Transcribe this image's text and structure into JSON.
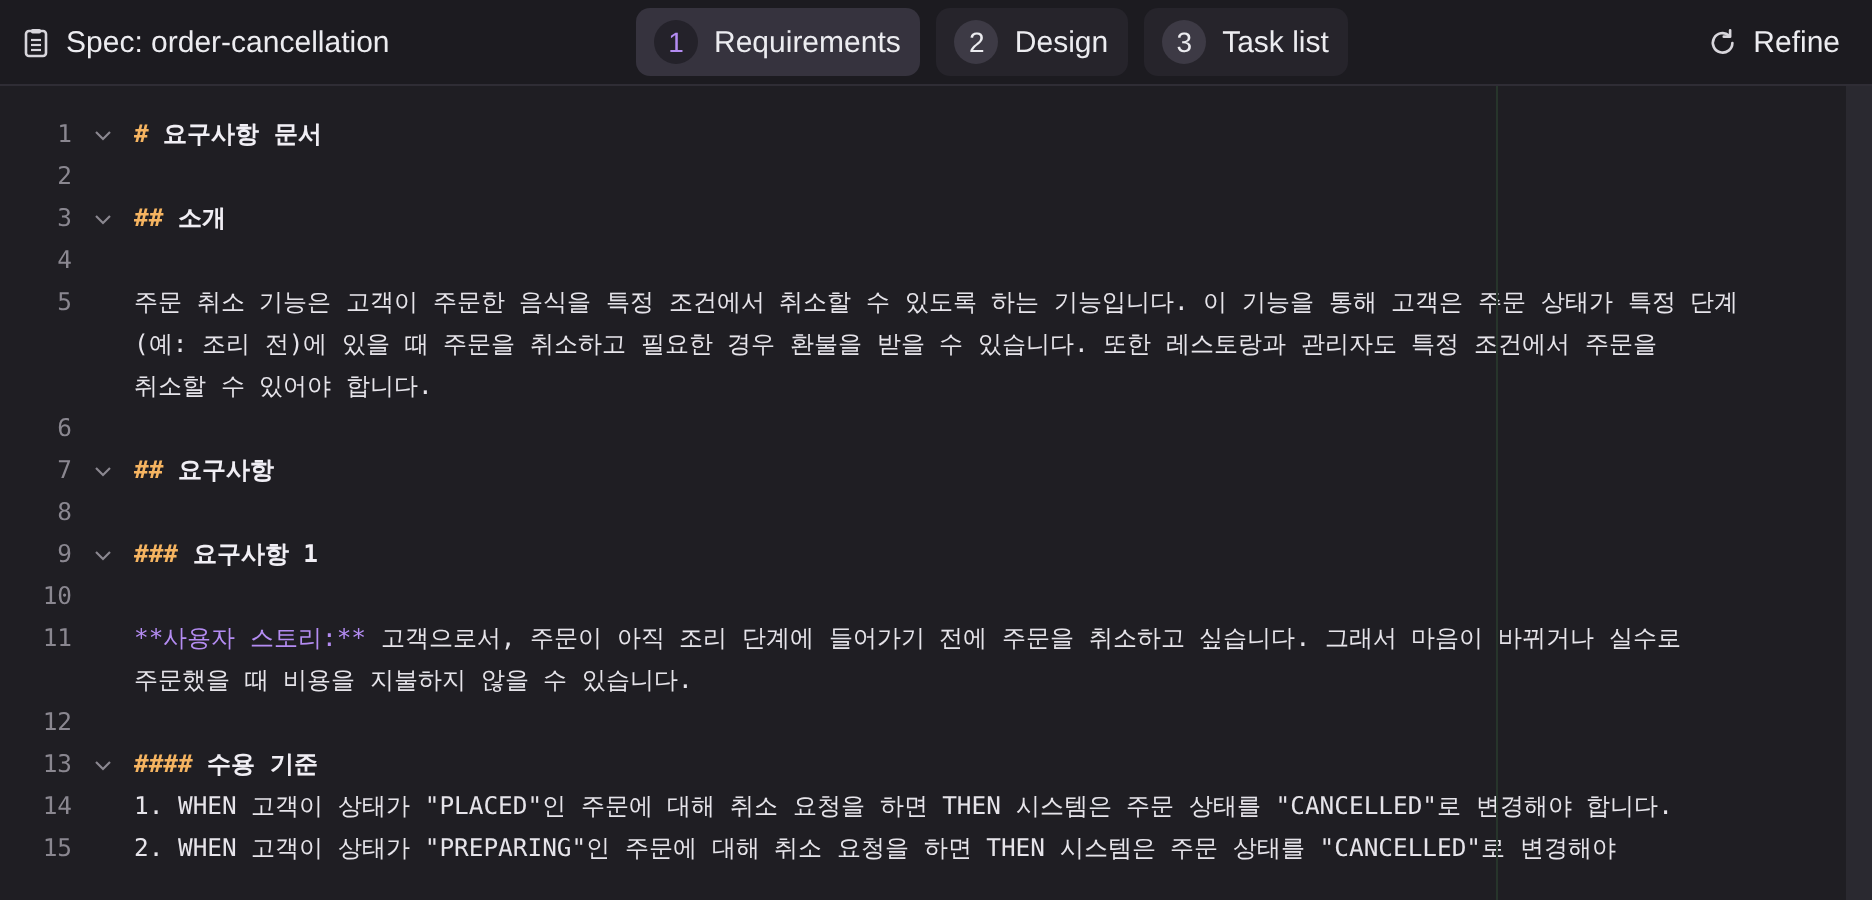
{
  "header": {
    "title": "Spec: order-cancellation",
    "refine": "Refine"
  },
  "tabs": [
    {
      "number": "1",
      "label": "Requirements",
      "selected": true
    },
    {
      "number": "2",
      "label": "Design",
      "selected": false
    },
    {
      "number": "3",
      "label": "Task list",
      "selected": false
    }
  ],
  "lines": [
    {
      "number": "1",
      "foldable": true,
      "rows": [
        [
          {
            "kind": "marker",
            "text": "#"
          },
          {
            "kind": "heading",
            "text": "요구사항 문서"
          }
        ]
      ]
    },
    {
      "number": "2",
      "foldable": false
    },
    {
      "number": "3",
      "foldable": true,
      "rows": [
        [
          {
            "kind": "marker",
            "text": "##"
          },
          {
            "kind": "heading",
            "text": "소개"
          }
        ]
      ]
    },
    {
      "number": "4",
      "foldable": false
    },
    {
      "number": "5",
      "foldable": false,
      "rows": [
        [
          {
            "kind": "plain",
            "text": "주문 취소 기능은 고객이 주문한 음식을 특정 조건에서 취소할 수 있도록 하는 기능입니다. 이 기능을 통해 고객은 주문 상태가 특정 단계"
          }
        ],
        [
          {
            "kind": "plain",
            "text": "(예: 조리 전)에 있을 때 주문을 취소하고 필요한 경우 환불을 받을 수 있습니다. 또한 레스토랑과 관리자도 특정 조건에서 주문을"
          }
        ],
        [
          {
            "kind": "plain",
            "text": "취소할 수 있어야 합니다."
          }
        ]
      ]
    },
    {
      "number": "6",
      "foldable": false
    },
    {
      "number": "7",
      "foldable": true,
      "rows": [
        [
          {
            "kind": "marker",
            "text": "##"
          },
          {
            "kind": "heading",
            "text": "요구사항"
          }
        ]
      ]
    },
    {
      "number": "8",
      "foldable": false
    },
    {
      "number": "9",
      "foldable": true,
      "rows": [
        [
          {
            "kind": "marker",
            "text": "###"
          },
          {
            "kind": "heading",
            "text": "요구사항 1"
          }
        ]
      ]
    },
    {
      "number": "10",
      "foldable": false
    },
    {
      "number": "11",
      "foldable": false,
      "rows": [
        [
          {
            "kind": "emphasis",
            "text": "**사용자 스토리:**"
          },
          {
            "kind": "plain",
            "text": "고객으로서, 주문이 아직 조리 단계에 들어가기 전에 주문을 취소하고 싶습니다. 그래서 마음이 바뀌거나 실수로"
          }
        ],
        [
          {
            "kind": "plain",
            "text": "주문했을 때 비용을 지불하지 않을 수 있습니다."
          }
        ]
      ]
    },
    {
      "number": "12",
      "foldable": false
    },
    {
      "number": "13",
      "foldable": true,
      "rows": [
        [
          {
            "kind": "marker",
            "text": "####"
          },
          {
            "kind": "heading",
            "text": "수용 기준"
          }
        ]
      ]
    },
    {
      "number": "14",
      "foldable": false,
      "rows": [
        [
          {
            "kind": "plain",
            "text": "1. WHEN 고객이 상태가 \"PLACED\"인 주문에 대해 취소 요청을 하면 THEN 시스템은 주문 상태를 \"CANCELLED\"로 변경해야 합니다."
          }
        ]
      ]
    },
    {
      "number": "15",
      "foldable": false,
      "rows": [
        [
          {
            "kind": "plain",
            "text": "2. WHEN 고객이 상태가 \"PREPARING\"인 주문에 대해 취소 요청을 하면 THEN 시스템은 주문 상태를 \"CANCELLED\"로 변경해야"
          }
        ]
      ]
    }
  ]
}
